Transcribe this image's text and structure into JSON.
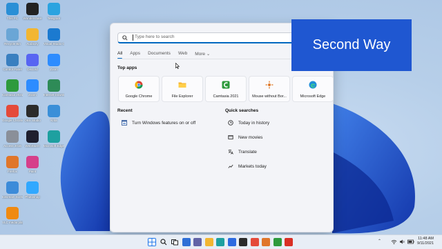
{
  "desktop": {
    "icons": [
      {
        "label": "This PC",
        "color": "#2a8fd6"
      },
      {
        "label": "Recycle Bin",
        "color": "#6aa6d6"
      },
      {
        "label": "Control Panel",
        "color": "#3a7fc0"
      },
      {
        "label": "Camtasia 2021",
        "color": "#2e9a3c"
      },
      {
        "label": "Google Chrome",
        "color": "#e44a3a"
      },
      {
        "label": "Access 2016",
        "color": "#8a8f99"
      },
      {
        "label": "Firefox",
        "color": "#e0762a"
      },
      {
        "label": "Icecream Screen",
        "color": "#3c8bd9"
      },
      {
        "label": "VLC media player",
        "color": "#f08a12"
      },
      {
        "label": "Wondershare",
        "color": "#222222"
      },
      {
        "label": "Audacity",
        "color": "#f2b632"
      },
      {
        "label": "Discord",
        "color": "#5865f2"
      },
      {
        "label": "Zoom",
        "color": "#2d8cff"
      },
      {
        "label": "OBS Studio",
        "color": "#2b2b2b"
      },
      {
        "label": "WebStorm",
        "color": "#1f1f2e"
      },
      {
        "label": "Paint",
        "color": "#d63f8a"
      },
      {
        "label": "Photoshop",
        "color": "#31a8ff"
      },
      {
        "label": "Telegram",
        "color": "#2aa3e0"
      },
      {
        "label": "Visual Studio Code",
        "color": "#1b7ad0"
      },
      {
        "label": "Zoom",
        "color": "#2d8cff"
      },
      {
        "label": "Internet Download",
        "color": "#2e8b57"
      },
      {
        "label": "Krita",
        "color": "#3a8fd8"
      },
      {
        "label": "Microsoft Edge",
        "color": "#1ea0a0"
      }
    ]
  },
  "start_menu": {
    "search_placeholder": "Type here to search",
    "tabs": [
      "All",
      "Apps",
      "Documents",
      "Web",
      "More"
    ],
    "more_chevron": "⌄",
    "top_apps_heading": "Top apps",
    "top_apps": [
      {
        "label": "Google Chrome",
        "icon": "chrome-icon"
      },
      {
        "label": "File Explorer",
        "icon": "folder-icon"
      },
      {
        "label": "Camtasia 2021",
        "icon": "camtasia-icon"
      },
      {
        "label": "Mouse without Bor...",
        "icon": "mouse-icon"
      },
      {
        "label": "Microsoft Edge",
        "icon": "edge-icon"
      }
    ],
    "recent_heading": "Recent",
    "recent": [
      {
        "label": "Turn Windows features on or off",
        "icon": "settings-window-icon"
      }
    ],
    "quick_heading": "Quick searches",
    "quick": [
      {
        "label": "Today in history",
        "icon": "clock-icon"
      },
      {
        "label": "New movies",
        "icon": "film-icon"
      },
      {
        "label": "Translate",
        "icon": "translate-icon"
      },
      {
        "label": "Markets today",
        "icon": "chart-icon"
      }
    ]
  },
  "banner": {
    "text": "Second Way"
  },
  "taskbar": {
    "clock_time": "11:48 AM",
    "clock_date": "9/11/2021",
    "apps": [
      {
        "name": "start",
        "color": "#1a73e8"
      },
      {
        "name": "search",
        "color": "#333333"
      },
      {
        "name": "task-view",
        "color": "#333333"
      },
      {
        "name": "widgets",
        "color": "#2f6fd6"
      },
      {
        "name": "chat",
        "color": "#6264a7"
      },
      {
        "name": "file-explorer",
        "color": "#f2b632"
      },
      {
        "name": "edge",
        "color": "#1ea0a0"
      },
      {
        "name": "store",
        "color": "#2d6be0"
      },
      {
        "name": "terminal",
        "color": "#2b2b2b"
      },
      {
        "name": "chrome",
        "color": "#e44a3a"
      },
      {
        "name": "firefox",
        "color": "#e0762a"
      },
      {
        "name": "camtasia",
        "color": "#2e9a3c"
      },
      {
        "name": "recorder",
        "color": "#d93025"
      }
    ]
  }
}
